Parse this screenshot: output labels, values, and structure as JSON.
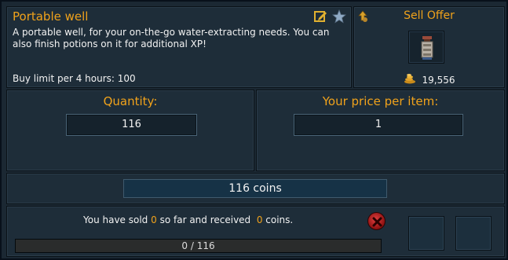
{
  "item": {
    "name": "Portable well",
    "description": "A portable well, for your on-the-go water-extracting needs. You can also finish potions on it for additional XP!",
    "buy_limit": "Buy limit per 4 hours: 100",
    "icons": [
      "edit-note-icon",
      "favourite-star-icon"
    ]
  },
  "offer": {
    "title": "Sell Offer",
    "type_icon": "sell-offer-icon",
    "item_icon": "portable-well-icon",
    "market_price": "19,556",
    "coins_icon": "coins-icon"
  },
  "quantity": {
    "label": "Quantity:",
    "value": "116"
  },
  "price": {
    "label": "Your price per item:",
    "value": "1"
  },
  "total": {
    "value": "116 coins"
  },
  "status": {
    "prefix": "You have sold ",
    "sold": "0",
    "middle": " so far and received  ",
    "received": "0",
    "suffix": " coins.",
    "abort_icon": "abort-offer-icon",
    "progress_text": "0 / 116",
    "progress_fraction": 0
  },
  "colors": {
    "accent": "#f0a21b",
    "panel": "#1e2d39",
    "abort": "#c62222"
  }
}
